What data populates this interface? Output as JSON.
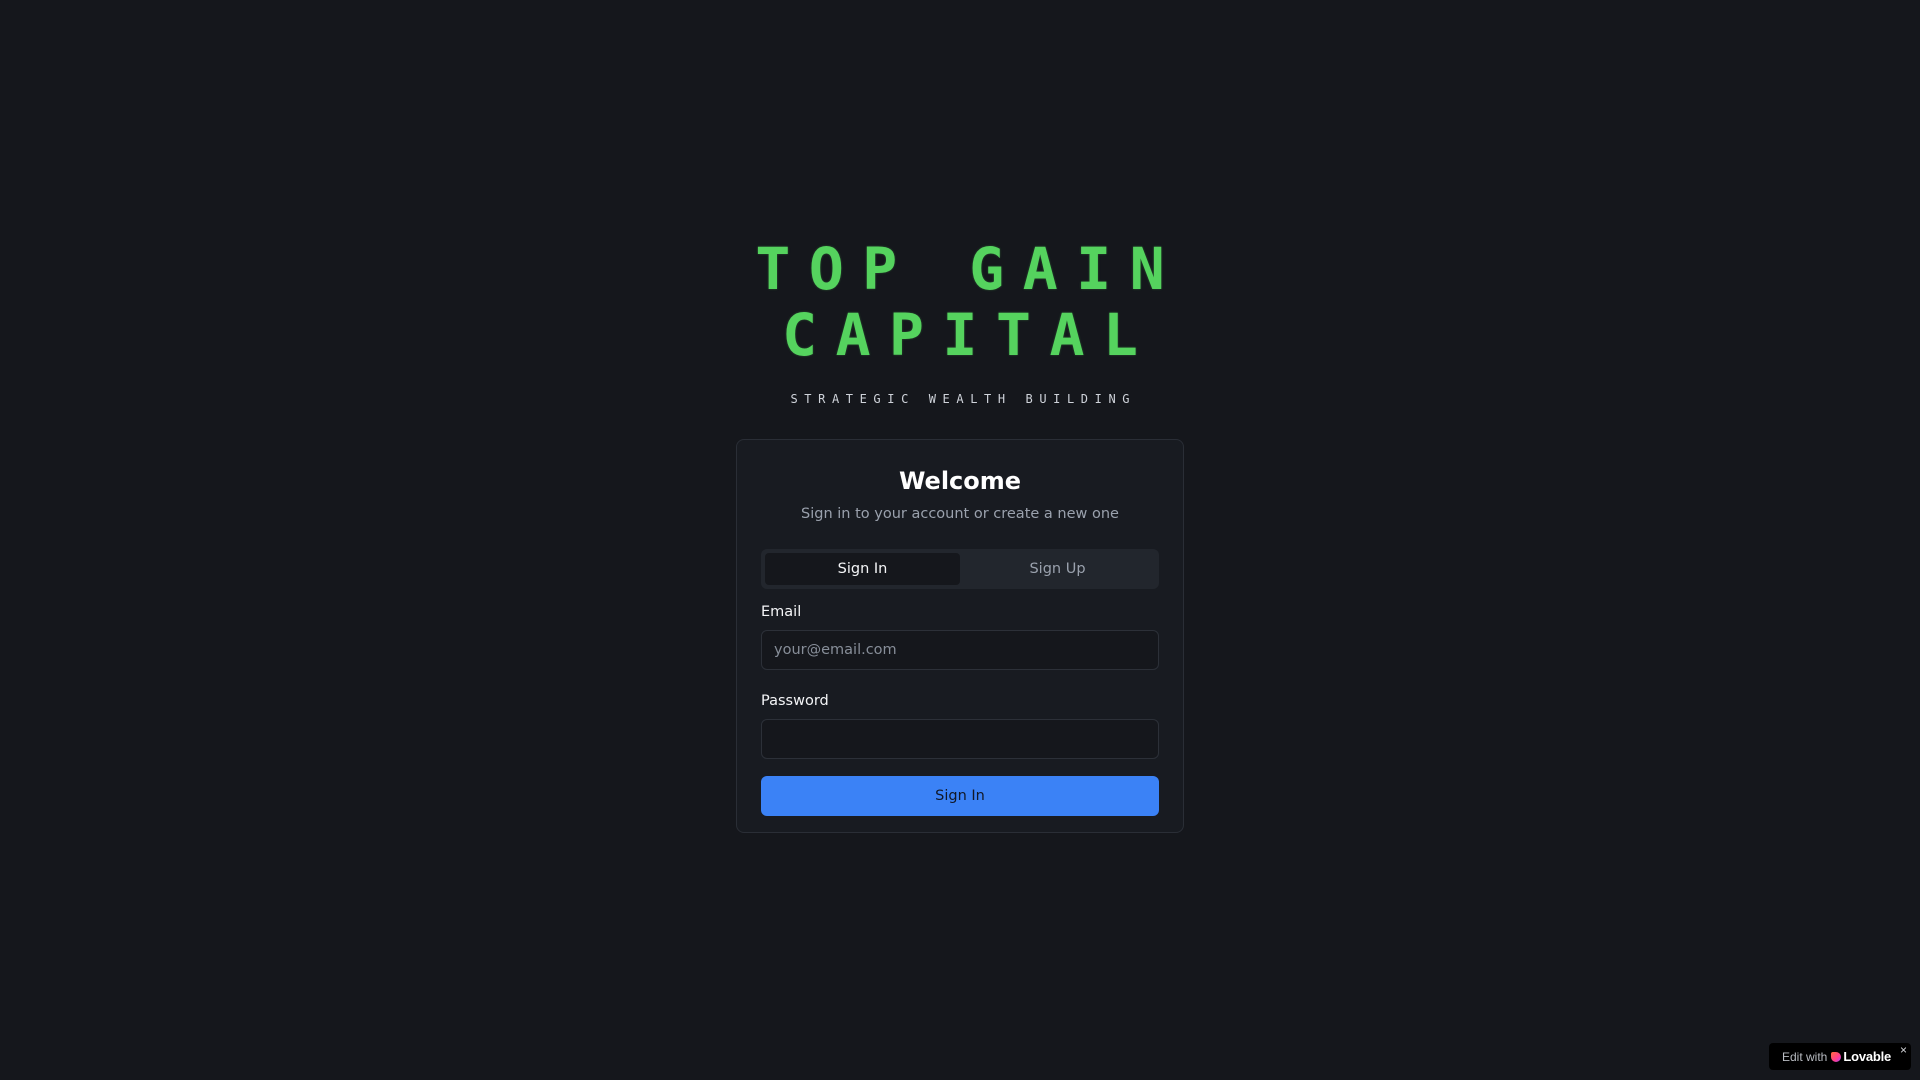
{
  "brand": {
    "logo_line_1": "TOP GAIN",
    "logo_line_2": "CAPITAL",
    "tagline": "STRATEGIC WEALTH BUILDING",
    "logo_color": "#55d35e"
  },
  "auth_card": {
    "title": "Welcome",
    "subtitle": "Sign in to your account or create a new one",
    "tabs": [
      {
        "label": "Sign In",
        "active": true
      },
      {
        "label": "Sign Up",
        "active": false
      }
    ],
    "email": {
      "label": "Email",
      "value": "",
      "placeholder": "your@email.com"
    },
    "password": {
      "label": "Password",
      "value": "",
      "placeholder": ""
    },
    "submit_label": "Sign In",
    "accent_color": "#3b82f6"
  },
  "badge": {
    "edit_text": "Edit with",
    "brand_text": "Lovable",
    "close_glyph": "×",
    "icon": "lovable-heart-icon"
  },
  "colors": {
    "background": "#15171c",
    "card_background": "#181b21"
  }
}
